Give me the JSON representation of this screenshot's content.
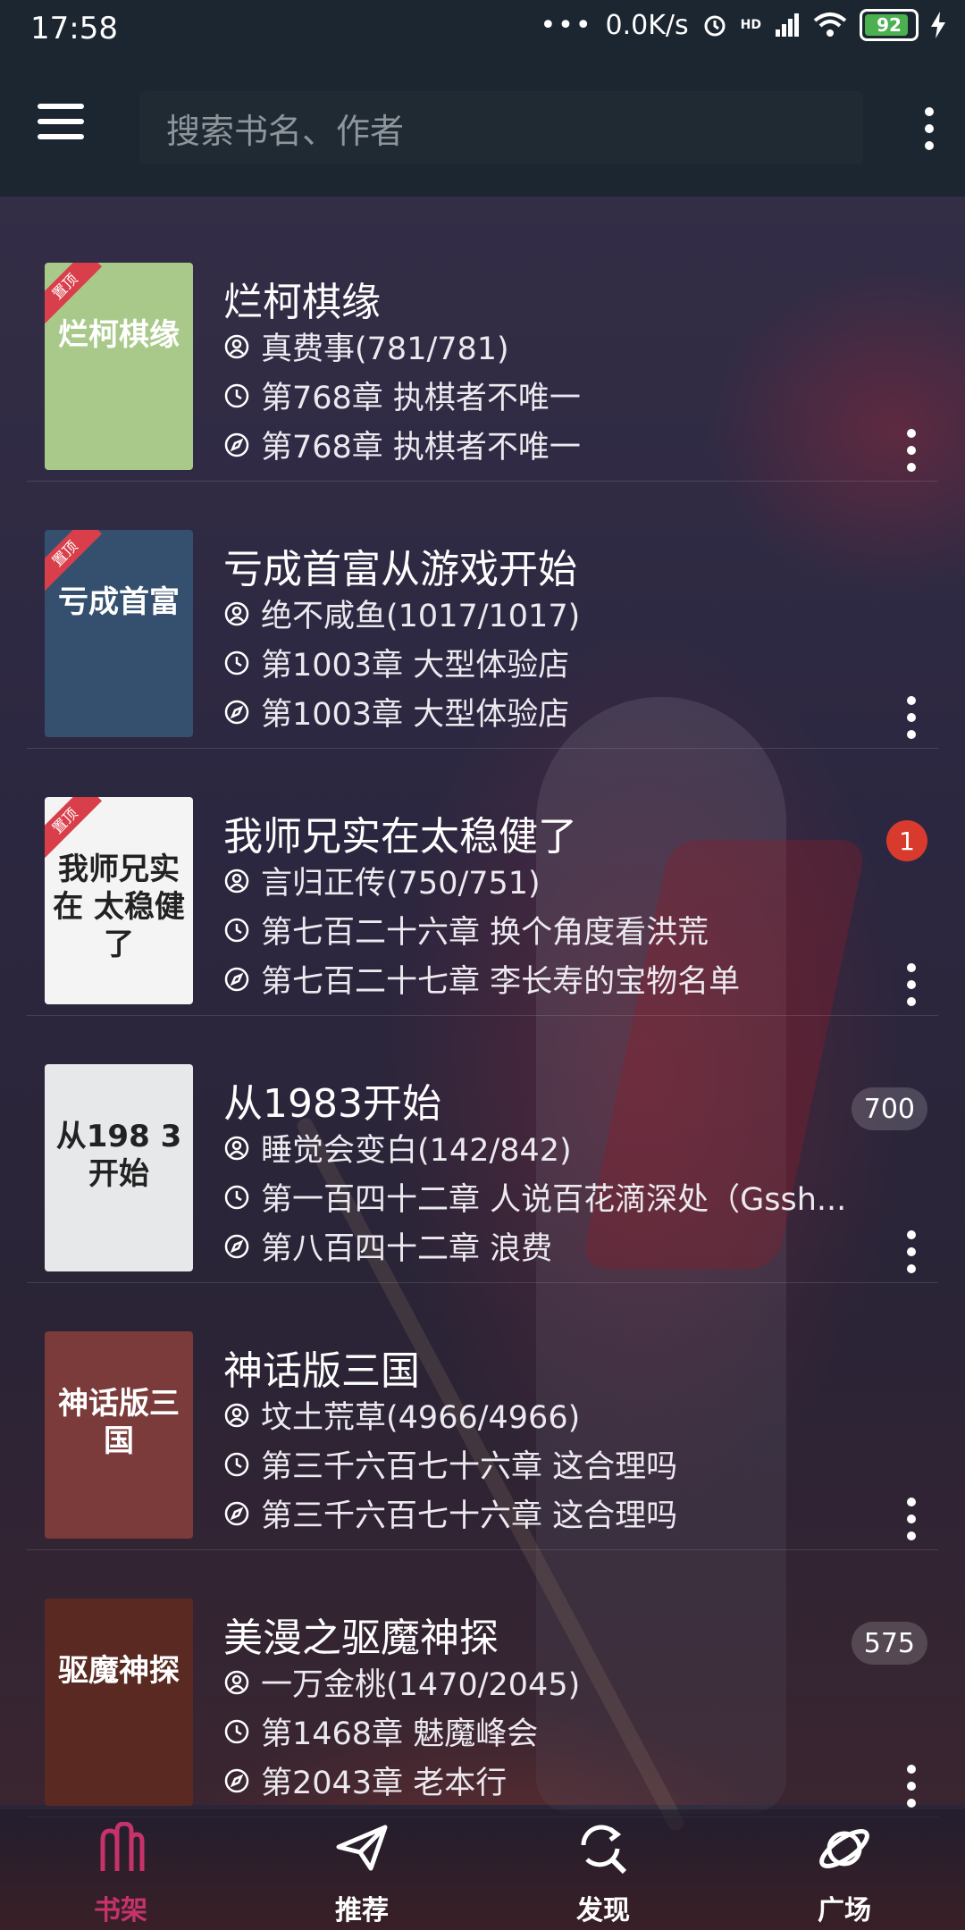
{
  "status": {
    "time": "17:58",
    "speed": "0.0K/s",
    "signal": "HD",
    "battery": "92"
  },
  "search": {
    "placeholder": "搜索书名、作者"
  },
  "books": [
    {
      "title": "烂柯棋缘",
      "author": "真费事(781/781)",
      "read": "第768章 执棋者不唯一",
      "latest": "第768章 执棋者不唯一",
      "pinned": true,
      "pin_label": "置顶",
      "cover_text": "烂柯棋缘",
      "cover_color": "#a9c98a",
      "badge": ""
    },
    {
      "title": "亏成首富从游戏开始",
      "author": "绝不咸鱼(1017/1017)",
      "read": "第1003章 大型体验店",
      "latest": "第1003章 大型体验店",
      "pinned": true,
      "pin_label": "置顶",
      "cover_text": "亏成首富",
      "cover_color": "#35506e",
      "badge": ""
    },
    {
      "title": "我师兄实在太稳健了",
      "author": "言归正传(750/751)",
      "read": "第七百二十六章 换个角度看洪荒",
      "latest": "第七百二十七章 李长寿的宝物名单",
      "pinned": true,
      "pin_label": "置顶",
      "cover_text": "我师兄实在 太稳健了",
      "cover_color": "#f4f4f4",
      "badge": "1"
    },
    {
      "title": "从1983开始",
      "author": "睡觉会变白(142/842)",
      "read": "第一百四十二章 人说百花滴深处（Gssh...",
      "latest": "第八百四十二章 浪费",
      "pinned": false,
      "pin_label": "",
      "cover_text": "从198 3开始",
      "cover_color": "#e6e8ea",
      "badge": "700"
    },
    {
      "title": "神话版三国",
      "author": "坟土荒草(4966/4966)",
      "read": "第三千六百七十六章 这合理吗",
      "latest": "第三千六百七十六章 这合理吗",
      "pinned": false,
      "pin_label": "",
      "cover_text": "神话版三国",
      "cover_color": "#7a3b3a",
      "badge": ""
    },
    {
      "title": "美漫之驱魔神探",
      "author": "一万金桃(1470/2045)",
      "read": "第1468章 魅魔峰会",
      "latest": "第2043章 老本行",
      "pinned": false,
      "pin_label": "",
      "cover_text": "驱魔神探",
      "cover_color": "#5a2a22",
      "badge": "575"
    }
  ],
  "nav": [
    {
      "label": "书架",
      "icon": "bookshelf-icon",
      "active": true
    },
    {
      "label": "推荐",
      "icon": "paper-plane-icon",
      "active": false
    },
    {
      "label": "发现",
      "icon": "discover-search-icon",
      "active": false
    },
    {
      "label": "广场",
      "icon": "planet-icon",
      "active": false
    }
  ],
  "colors": {
    "accent": "#c6336a",
    "badge_red": "#d93a2e",
    "appbar": "#1c2630"
  }
}
